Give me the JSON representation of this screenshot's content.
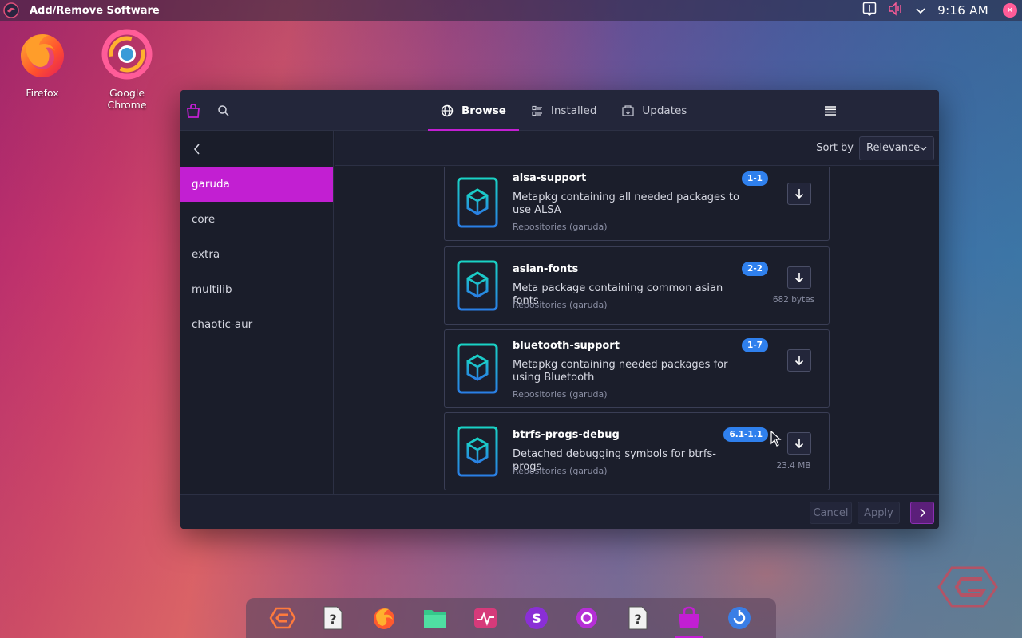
{
  "top_panel": {
    "title": "Add/Remove Software",
    "clock": "9:16 AM",
    "icons": [
      "garuda-menu-icon",
      "notification-icon",
      "volume-muted-icon",
      "chevron-down-icon",
      "user-badge-icon"
    ]
  },
  "desktop": {
    "icons": [
      {
        "label": "Firefox",
        "icon": "firefox-icon"
      },
      {
        "label": "Google Chrome",
        "icon": "chrome-icon"
      }
    ]
  },
  "window": {
    "tabs": [
      {
        "label": "Browse",
        "icon": "globe-icon",
        "active": true
      },
      {
        "label": "Installed",
        "icon": "list-icon",
        "active": false
      },
      {
        "label": "Updates",
        "icon": "updates-icon",
        "active": false
      }
    ],
    "sidebar": {
      "items": [
        {
          "label": "garuda",
          "active": true
        },
        {
          "label": "core",
          "active": false
        },
        {
          "label": "extra",
          "active": false
        },
        {
          "label": "multilib",
          "active": false
        },
        {
          "label": "chaotic-aur",
          "active": false
        }
      ]
    },
    "sort": {
      "label": "Sort by",
      "value": "Relevance"
    },
    "packages": [
      {
        "name": "alsa-support",
        "version": "1-1",
        "description": "Metapkg containing all needed packages to use ALSA",
        "repo": "Repositories (garuda)",
        "size": ""
      },
      {
        "name": "asian-fonts",
        "version": "2-2",
        "description": "Meta package containing common asian fonts",
        "repo": "Repositories (garuda)",
        "size": "682 bytes"
      },
      {
        "name": "bluetooth-support",
        "version": "1-7",
        "description": "Metapkg containing needed packages for using Bluetooth",
        "repo": "Repositories (garuda)",
        "size": ""
      },
      {
        "name": "btrfs-progs-debug",
        "version": "6.1-1.1",
        "description": "Detached debugging symbols for btrfs-progs",
        "repo": "Repositories (garuda)",
        "size": "23.4 MB"
      }
    ],
    "footer": {
      "cancel": "Cancel",
      "apply": "Apply"
    }
  },
  "dock": {
    "items": [
      "garuda-welcome-icon",
      "unknown-app-icon",
      "firedragon-icon",
      "files-icon",
      "system-monitor-icon",
      "garuda-settings-icon",
      "garuda-assistant-icon",
      "unknown-app-icon",
      "software-store-icon",
      "garuda-boot-options-icon"
    ]
  }
}
